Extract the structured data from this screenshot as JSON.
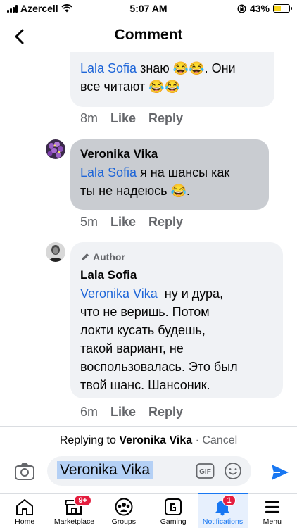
{
  "status_bar": {
    "carrier": "Azercell",
    "time": "5:07 AM",
    "battery": "43%",
    "battery_level": 0.43
  },
  "header": {
    "title": "Comment"
  },
  "comments": [
    {
      "mention": "Lala Sofia",
      "line1_rest": " знаю 😂😂. Они",
      "line2": "все читают 😂😂",
      "time": "8m",
      "like": "Like",
      "reply": "Reply"
    },
    {
      "author": "Veronika Vika",
      "mention": "Lala Sofia",
      "line1_rest": " я на шансы как",
      "line2": "ты не надеюсь 😂.",
      "time": "5m",
      "like": "Like",
      "reply": "Reply"
    },
    {
      "badge": "Author",
      "author": "Lala Sofia",
      "mention": "Veronika Vika",
      "line1_rest": "  ну и дура,",
      "lines": [
        "что не веришь. Потом",
        "локти кусать будешь,",
        "такой вариант, не",
        "воспользовалась. Это был",
        "твой шанс. Шансоник."
      ],
      "time": "6m",
      "like": "Like",
      "reply": "Reply"
    }
  ],
  "reply_bar": {
    "prefix": "Replying to ",
    "target": "Veronika Vika",
    "separator": " · ",
    "cancel": "Cancel",
    "input_value": "Veronika Vika"
  },
  "tabbar": {
    "items": [
      {
        "label": "Home",
        "badge": ""
      },
      {
        "label": "Marketplace",
        "badge": "9+"
      },
      {
        "label": "Groups",
        "badge": ""
      },
      {
        "label": "Gaming",
        "badge": ""
      },
      {
        "label": "Notifications",
        "badge": "1"
      },
      {
        "label": "Menu",
        "badge": ""
      }
    ]
  },
  "colors": {
    "accent": "#1877f2",
    "mention": "#1d65d8",
    "badge": "#e41e3f",
    "bubble": "#f0f2f5"
  }
}
